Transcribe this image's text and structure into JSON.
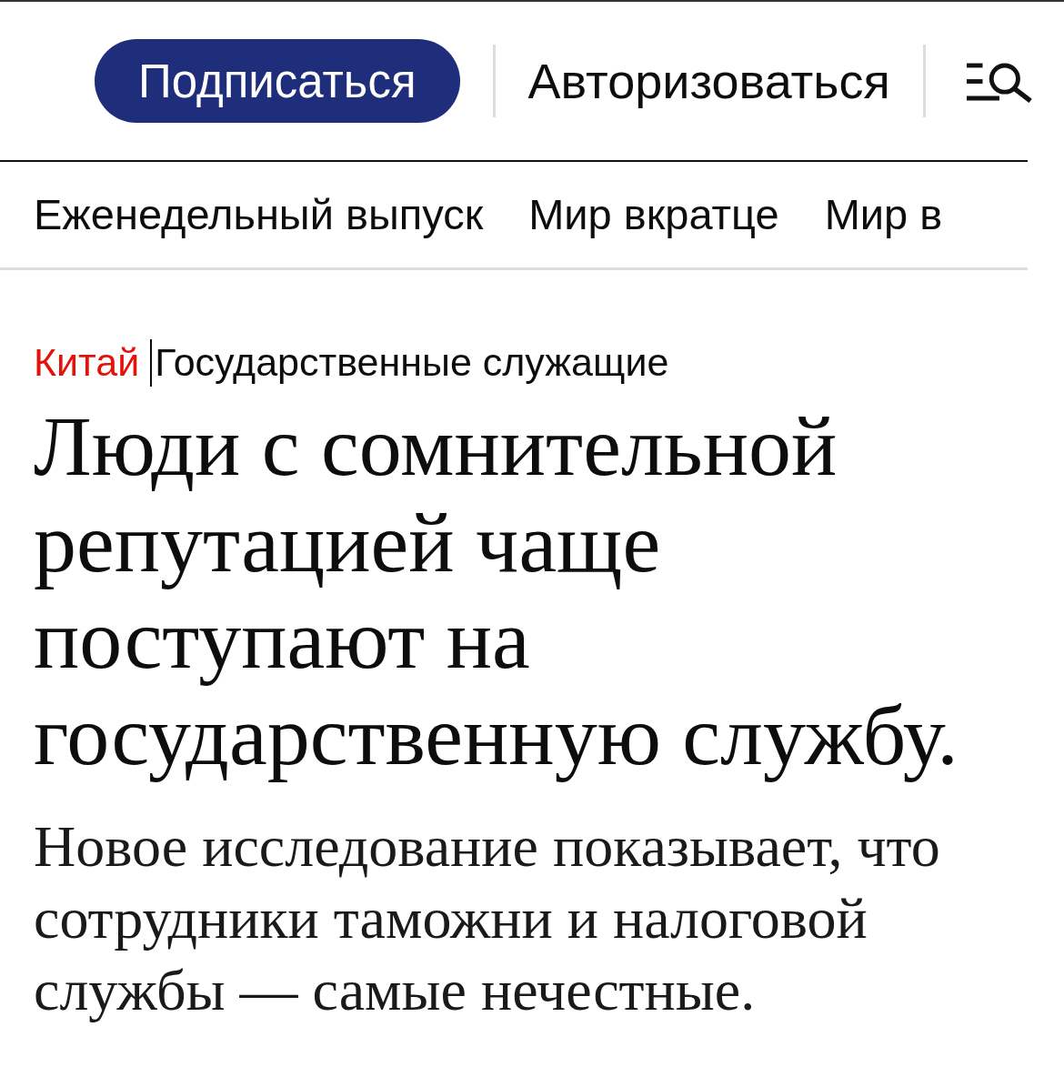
{
  "header": {
    "subscribe_button": "Подписаться",
    "login_link": "Авторизоваться"
  },
  "nav": {
    "items": [
      {
        "label": "Еженедельный выпуск"
      },
      {
        "label": "Мир вкратце"
      },
      {
        "label": "Мир в"
      }
    ]
  },
  "article": {
    "section": "Китай",
    "topic": "Государственные служащие",
    "headline": "Люди с сомнительной репутацией чаще поступают на государственную службу.",
    "description": "Новое исследование показывает, что сотрудники таможни и налоговой службы — самые нечестные."
  }
}
